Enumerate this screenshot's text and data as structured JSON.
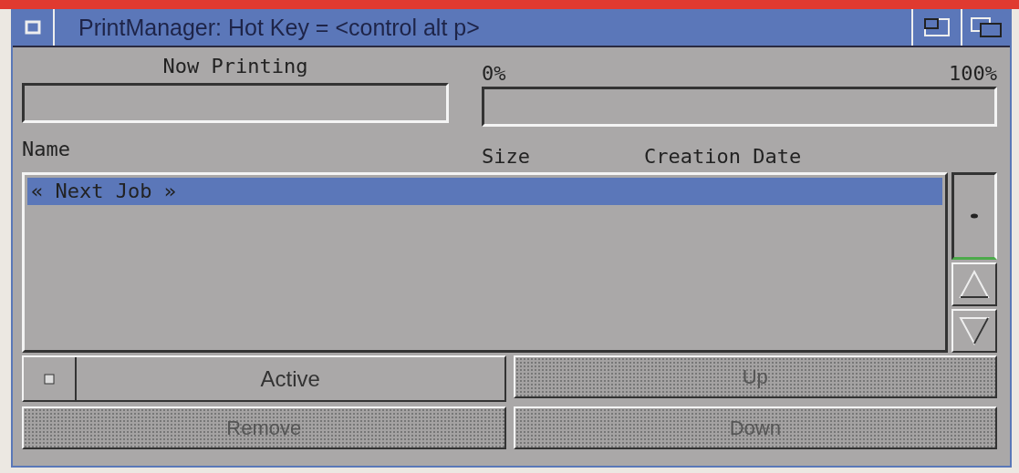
{
  "window": {
    "title": "PrintManager: Hot Key = <control alt p>"
  },
  "now_printing": {
    "label": "Now Printing"
  },
  "progress": {
    "start_label": "0%",
    "end_label": "100%"
  },
  "columns": [
    "Name",
    "Size",
    "Creation Date"
  ],
  "jobs": [
    {
      "name": "« Next Job »",
      "selected": true
    }
  ],
  "active": {
    "label": "Active",
    "checked": false
  },
  "buttons": [
    {
      "label": "Up",
      "disabled": true
    },
    {
      "label": "Remove",
      "disabled": true
    },
    {
      "label": "Down",
      "disabled": true
    }
  ]
}
